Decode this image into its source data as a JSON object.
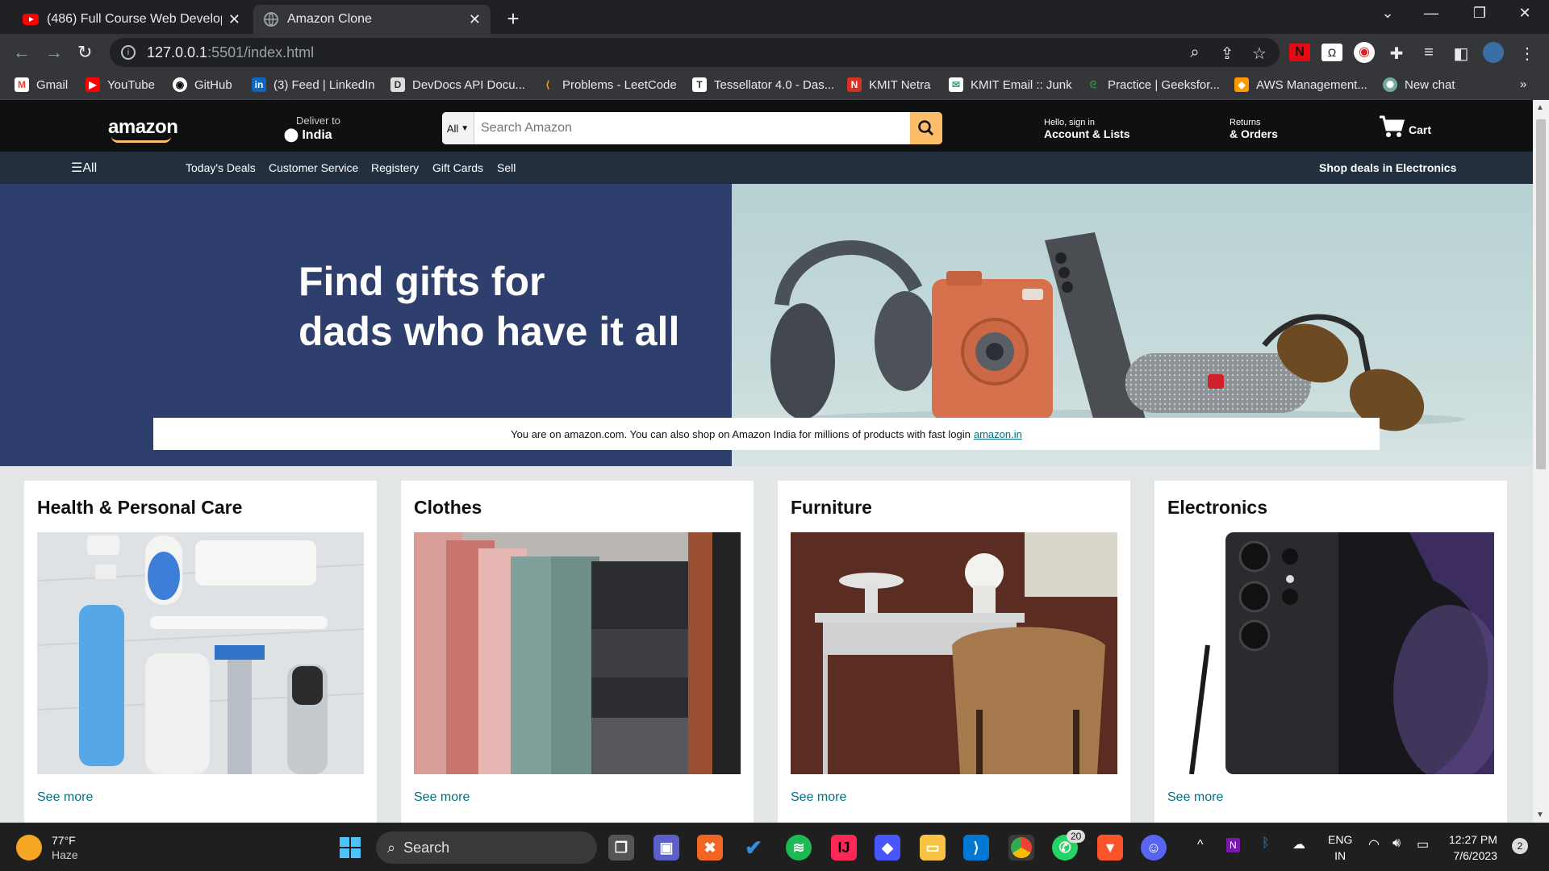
{
  "browser": {
    "tabs": [
      {
        "title": "(486) Full Course Web Developm"
      },
      {
        "title": "Amazon Clone"
      }
    ],
    "url": {
      "host": "127.0.0.1",
      "path": ":5501/index.html"
    },
    "bookmarks": [
      {
        "label": "Gmail",
        "icon": "gmail-icon"
      },
      {
        "label": "YouTube",
        "icon": "youtube-icon"
      },
      {
        "label": "GitHub",
        "icon": "github-icon"
      },
      {
        "label": "(3) Feed | LinkedIn",
        "icon": "linkedin-icon"
      },
      {
        "label": "DevDocs API Docu...",
        "icon": "devdocs-icon"
      },
      {
        "label": "Problems - LeetCode",
        "icon": "leetcode-icon"
      },
      {
        "label": "Tessellator 4.0 - Das...",
        "icon": "tessellator-icon"
      },
      {
        "label": "KMIT Netra",
        "icon": "netra-icon"
      },
      {
        "label": "KMIT Email :: Junk",
        "icon": "mail-icon"
      },
      {
        "label": "Practice | Geeksfor...",
        "icon": "gfg-icon"
      },
      {
        "label": "AWS Management...",
        "icon": "aws-icon"
      },
      {
        "label": "New chat",
        "icon": "chatgpt-icon"
      }
    ],
    "more_bookmarks": "»"
  },
  "amazon": {
    "logo": "amazon",
    "deliver": {
      "line1": "Deliver to",
      "line2": "India"
    },
    "search": {
      "category": "All",
      "placeholder": "Search Amazon"
    },
    "account": {
      "small": "Hello, sign in",
      "bold": "Account & Lists"
    },
    "returns": {
      "small": "Returns",
      "bold": "& Orders"
    },
    "cart": "Cart",
    "nav": {
      "all": "All",
      "links": [
        "Today's Deals",
        "Customer Service",
        "Registery",
        "Gift Cards",
        "Sell"
      ],
      "promo": "Shop deals in Electronics"
    },
    "hero": {
      "line1": "Find gifts for",
      "line2": "dads who have it all",
      "notice": "You are on amazon.com. You can also shop on Amazon India for millions of products with fast login",
      "notice_link": "amazon.in"
    },
    "cards": [
      {
        "title": "Health & Personal Care",
        "link": "See more"
      },
      {
        "title": "Clothes",
        "link": "See more"
      },
      {
        "title": "Furniture",
        "link": "See more"
      },
      {
        "title": "Electronics",
        "link": "See more"
      }
    ],
    "colors": {
      "nav_top": "#0f1111",
      "nav_bottom": "#232f3e",
      "search_button": "#febd69",
      "hero_left": "#2e3f6e",
      "link": "#007185"
    }
  },
  "taskbar": {
    "weather": {
      "temp": "77°F",
      "desc": "Haze"
    },
    "search": "Search",
    "whatsapp_badge": "20",
    "lang": {
      "l1": "ENG",
      "l2": "IN"
    },
    "time": "12:27 PM",
    "date": "7/6/2023",
    "notif": "2"
  }
}
